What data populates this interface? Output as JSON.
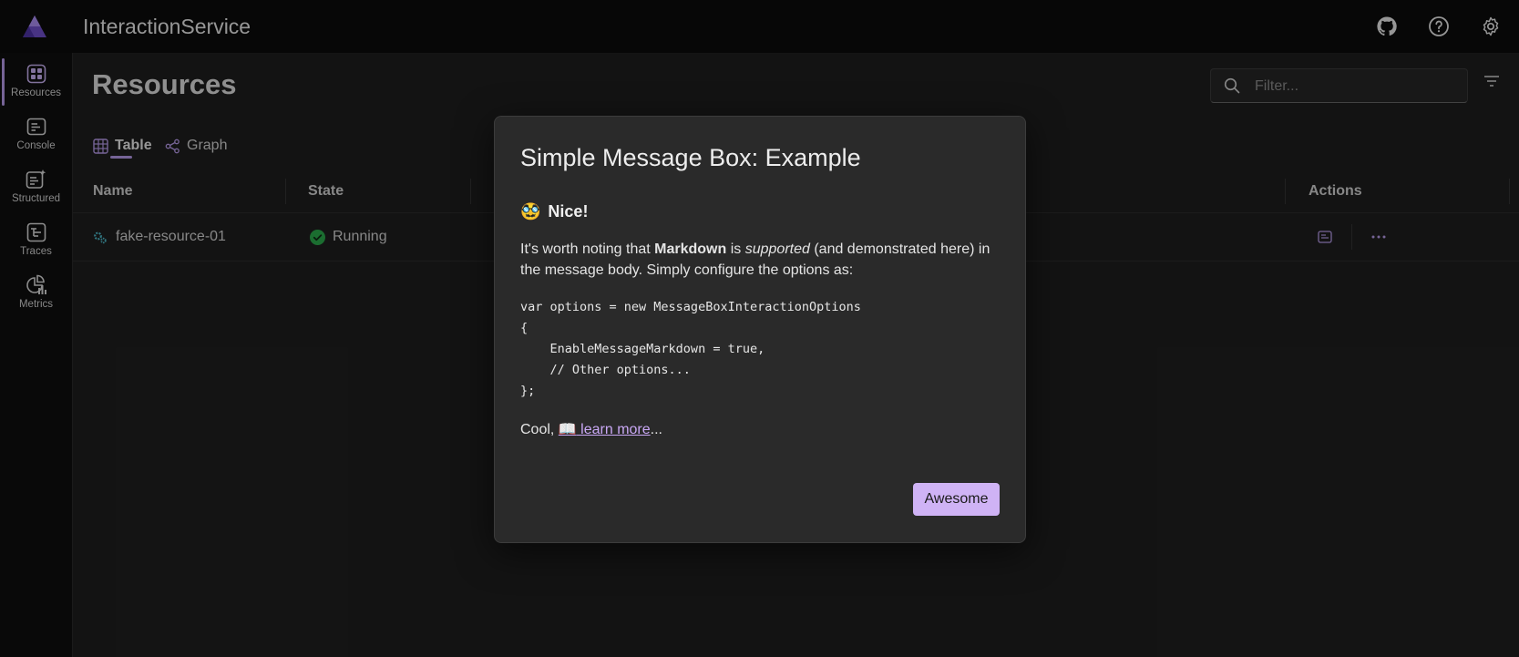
{
  "app": {
    "title": "InteractionService"
  },
  "sidebar": {
    "items": [
      {
        "label": "Resources",
        "icon": "resources-icon"
      },
      {
        "label": "Console",
        "icon": "console-icon"
      },
      {
        "label": "Structured",
        "icon": "structured-icon"
      },
      {
        "label": "Traces",
        "icon": "traces-icon"
      },
      {
        "label": "Metrics",
        "icon": "metrics-icon"
      }
    ]
  },
  "header": {
    "icons": [
      "github-icon",
      "help-icon",
      "settings-icon"
    ]
  },
  "main": {
    "title": "Resources",
    "filter_placeholder": "Filter...",
    "tabs": [
      {
        "label": "Table"
      },
      {
        "label": "Graph"
      }
    ],
    "table": {
      "columns": [
        "Name",
        "State",
        "Actions"
      ],
      "rows": [
        {
          "name": "fake-resource-01",
          "state": "Running"
        }
      ]
    }
  },
  "dialog": {
    "title": "Simple Message Box: Example",
    "heading_emoji": "🥸",
    "heading": "Nice!",
    "para_1": "It's worth noting that ",
    "para_bold": "Markdown",
    "para_2": " is ",
    "para_italic": "supported",
    "para_3": " (and demonstrated here) in the message body. Simply configure the options as:",
    "code": "var options = new MessageBoxInteractionOptions\n{\n    EnableMessageMarkdown = true,\n    // Other options...\n};",
    "footer_prefix": "Cool, ",
    "link_emoji": "📖",
    "link_text": " learn more",
    "footer_suffix": "...",
    "button_label": "Awesome"
  },
  "colors": {
    "accent": "#b69ae8",
    "button": "#cfb3f5",
    "running": "#2aa84a"
  }
}
